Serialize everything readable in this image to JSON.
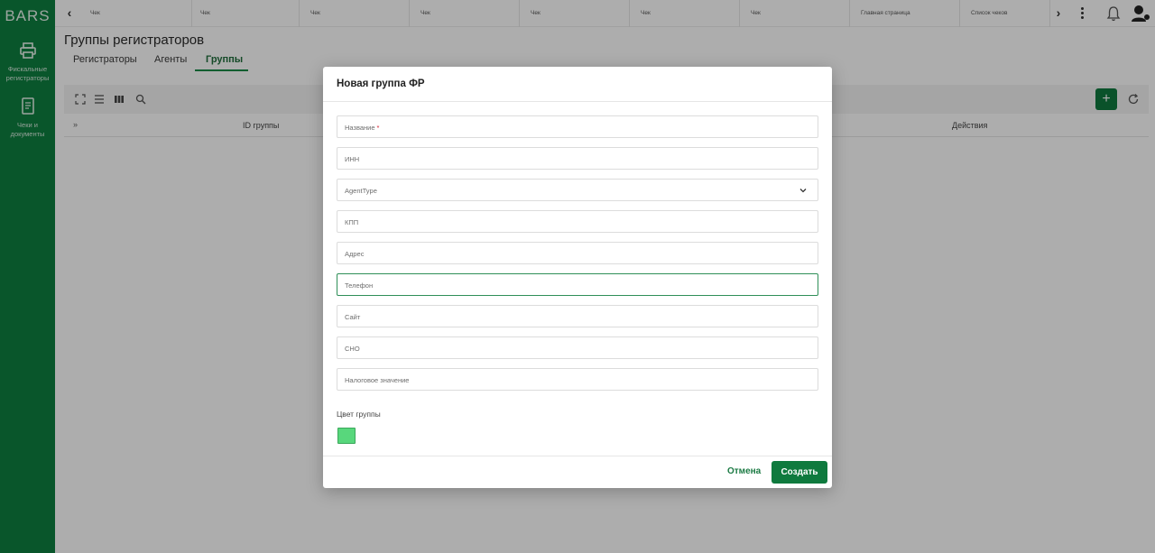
{
  "app": {
    "logo": "BARS"
  },
  "sidebar": {
    "items": [
      {
        "label": "Фискальные регистраторы",
        "icon": "printer-icon"
      },
      {
        "label": "Чеки и документы",
        "icon": "receipt-icon"
      }
    ]
  },
  "topbar": {
    "tabs": [
      "Чек",
      "Чек",
      "Чек",
      "Чек",
      "Чек",
      "Чек",
      "Чек",
      "Главная страница",
      "Список чеков"
    ]
  },
  "page": {
    "title": "Группы регистраторов",
    "tabs": [
      {
        "label": "Регистраторы"
      },
      {
        "label": "Агенты"
      },
      {
        "label": "Группы",
        "active": true
      }
    ]
  },
  "table": {
    "columns": [
      "ID группы",
      "Действия"
    ]
  },
  "modal": {
    "title": "Новая группа ФР",
    "fields": [
      {
        "placeholder": "Название",
        "required": "*"
      },
      {
        "placeholder": "ИНН"
      },
      {
        "placeholder": "AgentType",
        "type": "select"
      },
      {
        "placeholder": "КПП"
      },
      {
        "placeholder": "Адрес"
      },
      {
        "placeholder": "Телефон",
        "focused": true
      },
      {
        "placeholder": "Сайт"
      },
      {
        "placeholder": "СНО"
      },
      {
        "placeholder": "Налоговое значение"
      }
    ],
    "color_label": "Цвет группы",
    "color_value": "#58d77c",
    "cancel_label": "Отмена",
    "create_label": "Создать"
  },
  "colors": {
    "brand": "#0e7f40",
    "accent": "#0f7a3e"
  }
}
